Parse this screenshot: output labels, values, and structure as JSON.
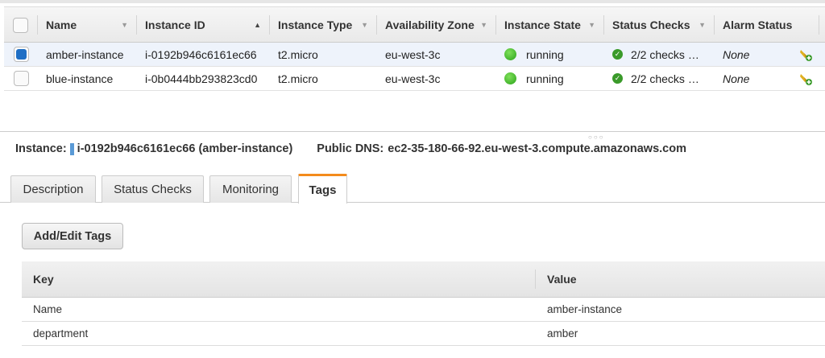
{
  "instances": {
    "columns": [
      "Name",
      "Instance ID",
      "Instance Type",
      "Availability Zone",
      "Instance State",
      "Status Checks",
      "Alarm Status"
    ],
    "rows": [
      {
        "name": "amber-instance",
        "id": "i-0192b946c6161ec66",
        "type": "t2.micro",
        "zone": "eu-west-3c",
        "state": "running",
        "checks": "2/2 checks …",
        "alarm": "None",
        "selected": true
      },
      {
        "name": "blue-instance",
        "id": "i-0b0444bb293823cd0",
        "type": "t2.micro",
        "zone": "eu-west-3c",
        "state": "running",
        "checks": "2/2 checks …",
        "alarm": "None",
        "selected": false
      }
    ]
  },
  "details": {
    "instance_label": "Instance:",
    "instance_value": "i-0192b946c6161ec66 (amber-instance)",
    "dns_label": "Public DNS:",
    "dns_value": "ec2-35-180-66-92.eu-west-3.compute.amazonaws.com",
    "tabs": [
      "Description",
      "Status Checks",
      "Monitoring",
      "Tags"
    ],
    "active_tab": "Tags",
    "add_edit_button": "Add/Edit Tags",
    "tags_columns": [
      "Key",
      "Value"
    ],
    "tags": [
      {
        "key": "Name",
        "value": "amber-instance"
      },
      {
        "key": "department",
        "value": "amber"
      }
    ]
  }
}
